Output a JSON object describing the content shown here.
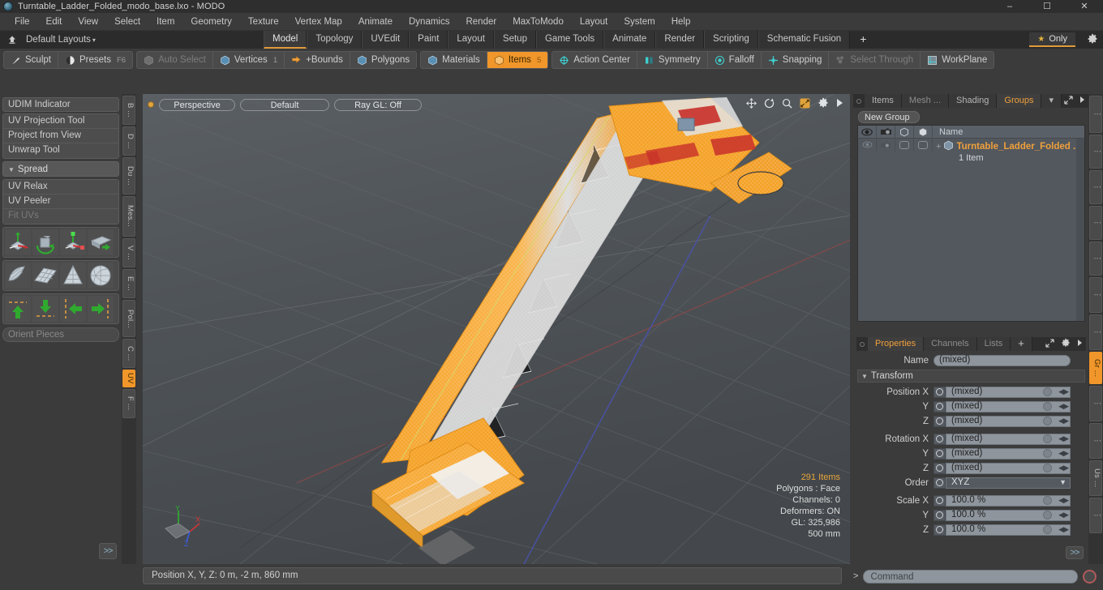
{
  "window": {
    "title": "Turntable_Ladder_Folded_modo_base.lxo - MODO",
    "app_icon": "modo-app-icon",
    "minimize": "–",
    "maximize": "☐",
    "close": "✕"
  },
  "menubar": {
    "items": [
      "File",
      "Edit",
      "View",
      "Select",
      "Item",
      "Geometry",
      "Texture",
      "Vertex Map",
      "Animate",
      "Dynamics",
      "Render",
      "MaxToModo",
      "Layout",
      "System",
      "Help"
    ]
  },
  "layoutbar": {
    "home_icon": "home-icon",
    "layout_label": "Default Layouts",
    "caret": "▾",
    "tabs": [
      {
        "label": "Model",
        "active": true
      },
      {
        "label": "Topology",
        "active": false
      },
      {
        "label": "UVEdit",
        "active": false
      },
      {
        "label": "Paint",
        "active": false
      },
      {
        "label": "Layout",
        "active": false
      },
      {
        "label": "Setup",
        "active": false
      },
      {
        "label": "Game Tools",
        "active": false
      },
      {
        "label": "Animate",
        "active": false
      },
      {
        "label": "Render",
        "active": false
      },
      {
        "label": "Scripting",
        "active": false
      },
      {
        "label": "Schematic Fusion",
        "active": false
      }
    ],
    "add_tab": "+",
    "only_label": "Only",
    "star_icon": "star-icon",
    "gear_icon": "gear-icon"
  },
  "modebar": {
    "left_group": [
      {
        "label": "Sculpt",
        "icon": "sculpt-icon",
        "state": "normal",
        "badge": ""
      },
      {
        "label": "Presets",
        "icon": "presets-icon",
        "state": "normal",
        "badge": "F6"
      }
    ],
    "select_group": [
      {
        "label": "Auto Select",
        "icon": "cube-gray-icon",
        "state": "dim",
        "badge": ""
      },
      {
        "label": "Vertices",
        "icon": "cube-blue-icon",
        "state": "normal",
        "badge": "1"
      },
      {
        "label": "+Bounds",
        "icon": "bounds-icon",
        "state": "normal",
        "badge": ""
      },
      {
        "label": "Polygons",
        "icon": "cube-blue-icon",
        "state": "normal",
        "badge": ""
      }
    ],
    "items_group": [
      {
        "label": "Materials",
        "icon": "cube-blue-icon",
        "state": "normal",
        "badge": ""
      },
      {
        "label": "Items",
        "icon": "cube-orange-icon",
        "state": "on",
        "badge": "5"
      }
    ],
    "tools_group": [
      {
        "label": "Action Center",
        "icon": "action-center-icon",
        "state": "normal",
        "badge": ""
      },
      {
        "label": "Symmetry",
        "icon": "symmetry-icon",
        "state": "normal",
        "badge": ""
      },
      {
        "label": "Falloff",
        "icon": "falloff-icon",
        "state": "normal",
        "badge": ""
      },
      {
        "label": "Snapping",
        "icon": "snapping-icon",
        "state": "normal",
        "badge": ""
      },
      {
        "label": "Select Through",
        "icon": "select-through-icon",
        "state": "dim",
        "badge": ""
      },
      {
        "label": "WorkPlane",
        "icon": "workplane-icon",
        "state": "normal",
        "badge": ""
      }
    ]
  },
  "left_panel": {
    "udim": "UDIM Indicator",
    "uv_tools": [
      "UV Projection Tool",
      "Project from View",
      "Unwrap Tool"
    ],
    "spread_header": "Spread",
    "spread_tools": [
      "UV Relax",
      "UV Peeler",
      "Fit UVs"
    ],
    "icon_row_1": [
      "move-uv-icon",
      "rotate-uv-icon",
      "scale-uv-icon",
      "flip-uv-icon"
    ],
    "icon_row_2": [
      "drop-uv-icon",
      "grid-flat-icon",
      "cone-unwrap-icon",
      "sphere-uv-icon"
    ],
    "icon_row_3": [
      "align-up-icon",
      "align-down-icon",
      "align-left-icon",
      "align-right-icon"
    ],
    "orient_field": "Orient Pieces",
    "more_button": ">>",
    "vtabs": [
      "B ...",
      "D ...",
      "Du ...",
      "Mes...",
      "V ...",
      "E ...",
      "Pol...",
      "C ...",
      "UV",
      "F ..."
    ],
    "vtab_active": "UV"
  },
  "viewport": {
    "dot_icon": "viewport-active-dot",
    "pills": [
      "Perspective",
      "Default",
      "Ray GL: Off"
    ],
    "icons": [
      "pan-icon",
      "rotate-icon",
      "zoom-icon",
      "fit-icon",
      "gear-icon",
      "play-icon"
    ],
    "info": {
      "items": "291 Items",
      "polygons": "Polygons : Face",
      "channels": "Channels: 0",
      "deformers": "Deformers: ON",
      "gl": "GL: 325,986",
      "scale": "500 mm"
    },
    "gizmo": {
      "x": "X",
      "y": "Y",
      "z": "Z"
    },
    "model_color": "#F5A32A",
    "model_accent": "#C8302A",
    "bg_color": "#4e5256"
  },
  "right_panel": {
    "top_tabs": [
      {
        "label": "Items",
        "active": false
      },
      {
        "label": "Mesh ...",
        "active": false,
        "dim": true
      },
      {
        "label": "Shading",
        "active": false
      },
      {
        "label": "Groups",
        "active": true
      }
    ],
    "top_tabs_caret": "▾",
    "top_expand_icon": "expand-icon",
    "top_more_icon": "chevron-right-icon",
    "new_group_button": "New Group",
    "list_columns": [
      "eye-icon",
      "camera-icon",
      "cube-wire-icon",
      "cube-solid-icon",
      "Name"
    ],
    "list_rows": [
      {
        "expander": "+",
        "icon": "mesh-item-icon",
        "name": "Turntable_Ladder_Folded ...",
        "sub": "1 Item"
      }
    ],
    "prop_tabs": [
      {
        "label": "Properties",
        "active": true
      },
      {
        "label": "Channels",
        "active": false
      },
      {
        "label": "Lists",
        "active": false
      },
      {
        "label": "+",
        "active": false
      }
    ],
    "prop_expand_icon": "expand-icon",
    "prop_gear_icon": "gear-icon",
    "prop_more_icon": "chevron-right-icon",
    "name_label": "Name",
    "name_value": "(mixed)",
    "transform_header": "Transform",
    "rows": [
      {
        "label": "Position X",
        "value": "(mixed)"
      },
      {
        "label": "Y",
        "value": "(mixed)"
      },
      {
        "label": "Z",
        "value": "(mixed)"
      },
      {
        "label": "Rotation X",
        "value": "(mixed)"
      },
      {
        "label": "Y",
        "value": "(mixed)"
      },
      {
        "label": "Z",
        "value": "(mixed)"
      }
    ],
    "order_label": "Order",
    "order_value": "XYZ",
    "scale_rows": [
      {
        "label": "Scale X",
        "value": "100.0 %"
      },
      {
        "label": "Y",
        "value": "100.0 %"
      },
      {
        "label": "Z",
        "value": "100.0 %"
      }
    ],
    "more_button": ">>",
    "vtabs_top": [
      "⋮",
      "⋮",
      "⋮",
      "⋮",
      "⋮"
    ],
    "vtabs_bottom": [
      "⋮",
      "⋮",
      "Gr ...",
      "⋮",
      "⋮",
      "Us ...",
      "⋮"
    ],
    "vtab_active_index": 2
  },
  "statusbar": {
    "position_text": "Position X, Y, Z:   0 m, -2 m, 860 mm"
  },
  "command": {
    "prompt": ">",
    "placeholder": "Command",
    "record_icon": "record-icon"
  }
}
